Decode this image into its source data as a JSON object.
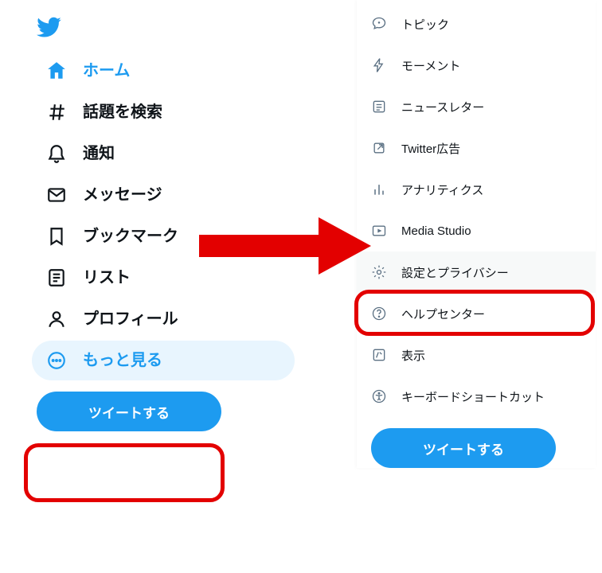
{
  "brand_color": "#1d9bf0",
  "highlight_color": "#e30000",
  "sidebar": {
    "items": [
      {
        "label": "ホーム",
        "icon": "home-icon",
        "active": true
      },
      {
        "label": "話題を検索",
        "icon": "hash-icon",
        "active": false
      },
      {
        "label": "通知",
        "icon": "bell-icon",
        "active": false
      },
      {
        "label": "メッセージ",
        "icon": "mail-icon",
        "active": false
      },
      {
        "label": "ブックマーク",
        "icon": "bookmark-icon",
        "active": false
      },
      {
        "label": "リスト",
        "icon": "list-icon",
        "active": false
      },
      {
        "label": "プロフィール",
        "icon": "profile-icon",
        "active": false
      },
      {
        "label": "もっと見る",
        "icon": "more-icon",
        "active": false,
        "open": true
      }
    ],
    "tweet_button": "ツイートする"
  },
  "more_menu": {
    "items": [
      {
        "label": "トピック",
        "icon": "chat-icon"
      },
      {
        "label": "モーメント",
        "icon": "bolt-icon"
      },
      {
        "label": "ニュースレター",
        "icon": "newsletter-icon"
      },
      {
        "label": "Twitter広告",
        "icon": "external-icon"
      },
      {
        "label": "アナリティクス",
        "icon": "analytics-icon"
      },
      {
        "label": "Media Studio",
        "icon": "media-icon"
      },
      {
        "label": "設定とプライバシー",
        "icon": "gear-icon",
        "selected": true
      },
      {
        "label": "ヘルプセンター",
        "icon": "help-icon"
      },
      {
        "label": "表示",
        "icon": "display-icon"
      },
      {
        "label": "キーボードショートカット",
        "icon": "accessibility-icon"
      }
    ],
    "tweet_button": "ツイートする"
  }
}
